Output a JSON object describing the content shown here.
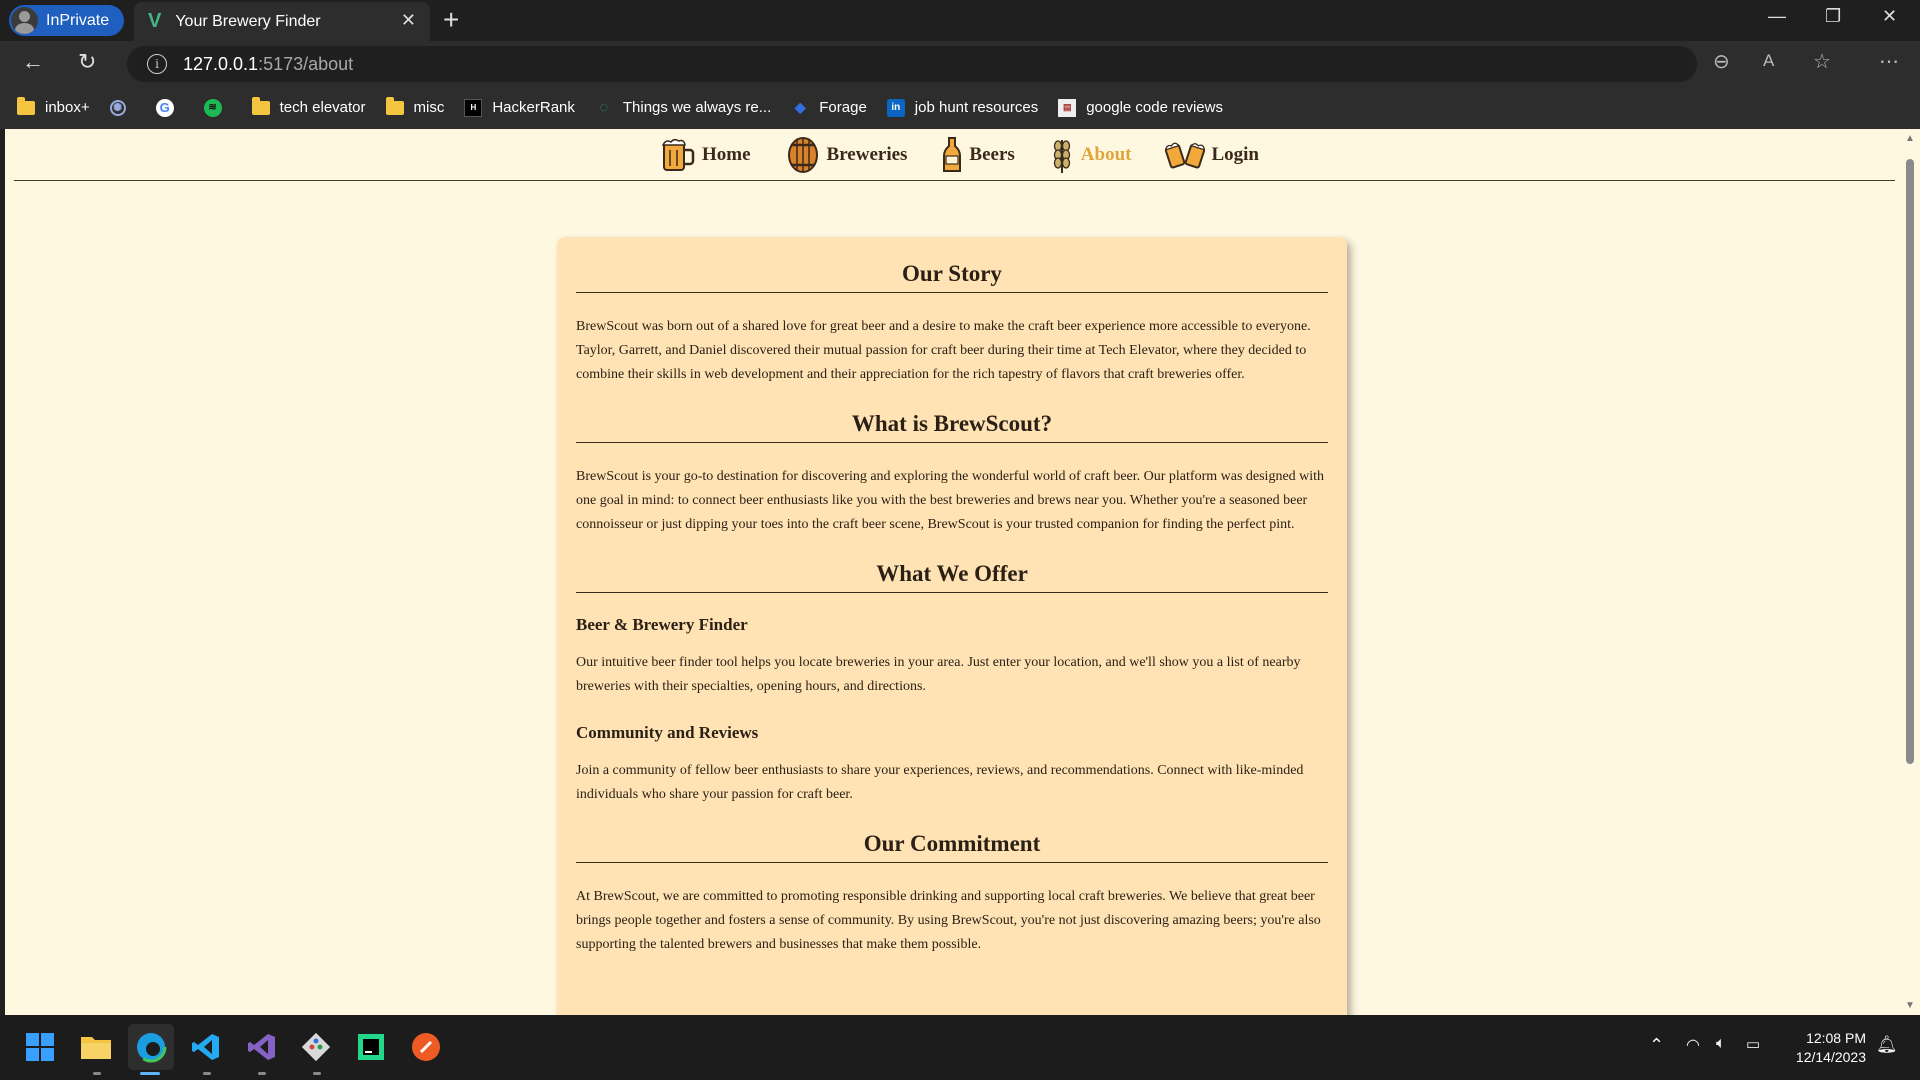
{
  "browser": {
    "profile_label": "InPrivate",
    "tab_title": "Your Brewery Finder",
    "url_host": "127.0.0.1",
    "url_path": ":5173/about"
  },
  "bookmarks": [
    {
      "label": "inbox+",
      "icon": "folder-icon"
    },
    {
      "label": "",
      "icon": "chatgpt-icon"
    },
    {
      "label": "",
      "icon": "google-icon"
    },
    {
      "label": "",
      "icon": "spotify-icon"
    },
    {
      "label": "tech elevator",
      "icon": "folder-icon"
    },
    {
      "label": "misc",
      "icon": "folder-icon"
    },
    {
      "label": "HackerRank",
      "icon": "hackerrank-icon"
    },
    {
      "label": "Things we always re...",
      "icon": "loading-icon"
    },
    {
      "label": "Forage",
      "icon": "forage-icon"
    },
    {
      "label": "job hunt resources",
      "icon": "linkedin-icon"
    },
    {
      "label": "google code reviews",
      "icon": "page-icon"
    }
  ],
  "site_nav": {
    "home": "Home",
    "breweries": "Breweries",
    "beers": "Beers",
    "about": "About",
    "login": "Login",
    "active_color": "#e0a53c"
  },
  "about": {
    "story_title": "Our Story",
    "story_text": "BrewScout was born out of a shared love for great beer and a desire to make the craft beer experience more accessible to everyone. Taylor, Garrett, and Daniel discovered their mutual passion for craft beer during their time at Tech Elevator, where they decided to combine their skills in web development and their appreciation for the rich tapestry of flavors that craft breweries offer.",
    "what_title": "What is BrewScout?",
    "what_text": "BrewScout is your go-to destination for discovering and exploring the wonderful world of craft beer. Our platform was designed with one goal in mind: to connect beer enthusiasts like you with the best breweries and brews near you. Whether you're a seasoned beer connoisseur or just dipping your toes into the craft beer scene, BrewScout is your trusted companion for finding the perfect pint.",
    "offer_title": "What We Offer",
    "finder_title": "Beer & Brewery Finder",
    "finder_text": "Our intuitive beer finder tool helps you locate breweries in your area. Just enter your location, and we'll show you a list of nearby breweries with their specialties, opening hours, and directions.",
    "community_title": "Community and Reviews",
    "community_text": "Join a community of fellow beer enthusiasts to share your experiences, reviews, and recommendations. Connect with like-minded individuals who share your passion for craft beer.",
    "commitment_title": "Our Commitment",
    "commitment_text": "At BrewScout, we are committed to promoting responsible drinking and supporting local craft breweries. We believe that great beer brings people together and fosters a sense of community. By using BrewScout, you're not just discovering amazing beers; you're also supporting the talented brewers and businesses that make them possible."
  },
  "taskbar": {
    "time": "12:08 PM",
    "date": "12/14/2023"
  }
}
